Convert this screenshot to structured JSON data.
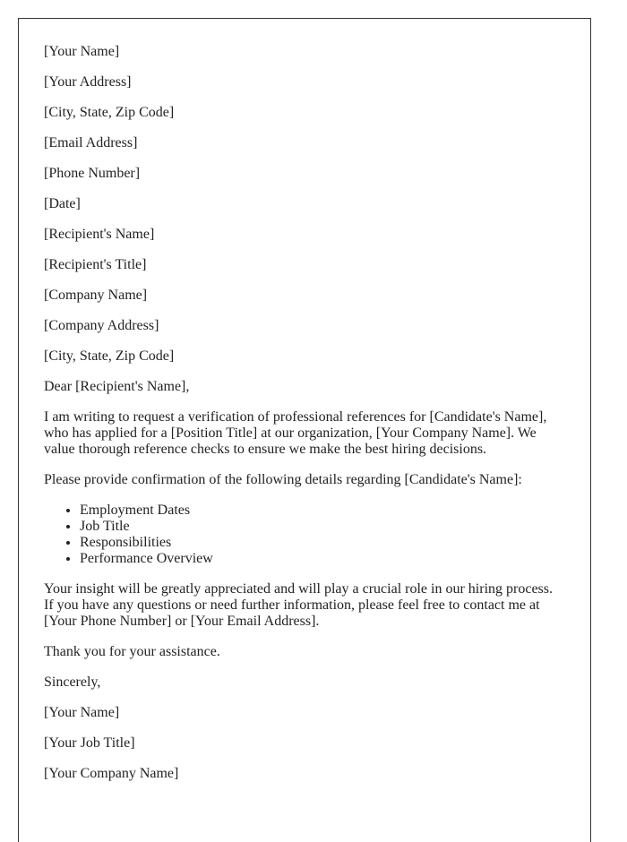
{
  "sender": {
    "name": "[Your Name]",
    "address": "[Your Address]",
    "city_state_zip": "[City, State, Zip Code]",
    "email": "[Email Address]",
    "phone": "[Phone Number]",
    "date": "[Date]"
  },
  "recipient": {
    "name": "[Recipient's Name]",
    "title": "[Recipient's Title]",
    "company": "[Company Name]",
    "company_address": "[Company Address]",
    "city_state_zip": "[City, State, Zip Code]"
  },
  "salutation": "Dear [Recipient's Name],",
  "body": {
    "intro": "I am writing to request a verification of professional references for [Candidate's Name], who has applied for a [Position Title] at our organization, [Your Company Name]. We value thorough reference checks to ensure we make the best hiring decisions.",
    "request": "Please provide confirmation of the following details regarding [Candidate's Name]:",
    "items": [
      "Employment Dates",
      "Job Title",
      "Responsibilities",
      "Performance Overview"
    ],
    "closing_paragraph": "Your insight will be greatly appreciated and will play a crucial role in our hiring process. If you have any questions or need further information, please feel free to contact me at [Your Phone Number] or [Your Email Address].",
    "thanks": "Thank you for your assistance."
  },
  "signoff": {
    "closing": "Sincerely,",
    "name": "[Your Name]",
    "job_title": "[Your Job Title]",
    "company": "[Your Company Name]"
  }
}
